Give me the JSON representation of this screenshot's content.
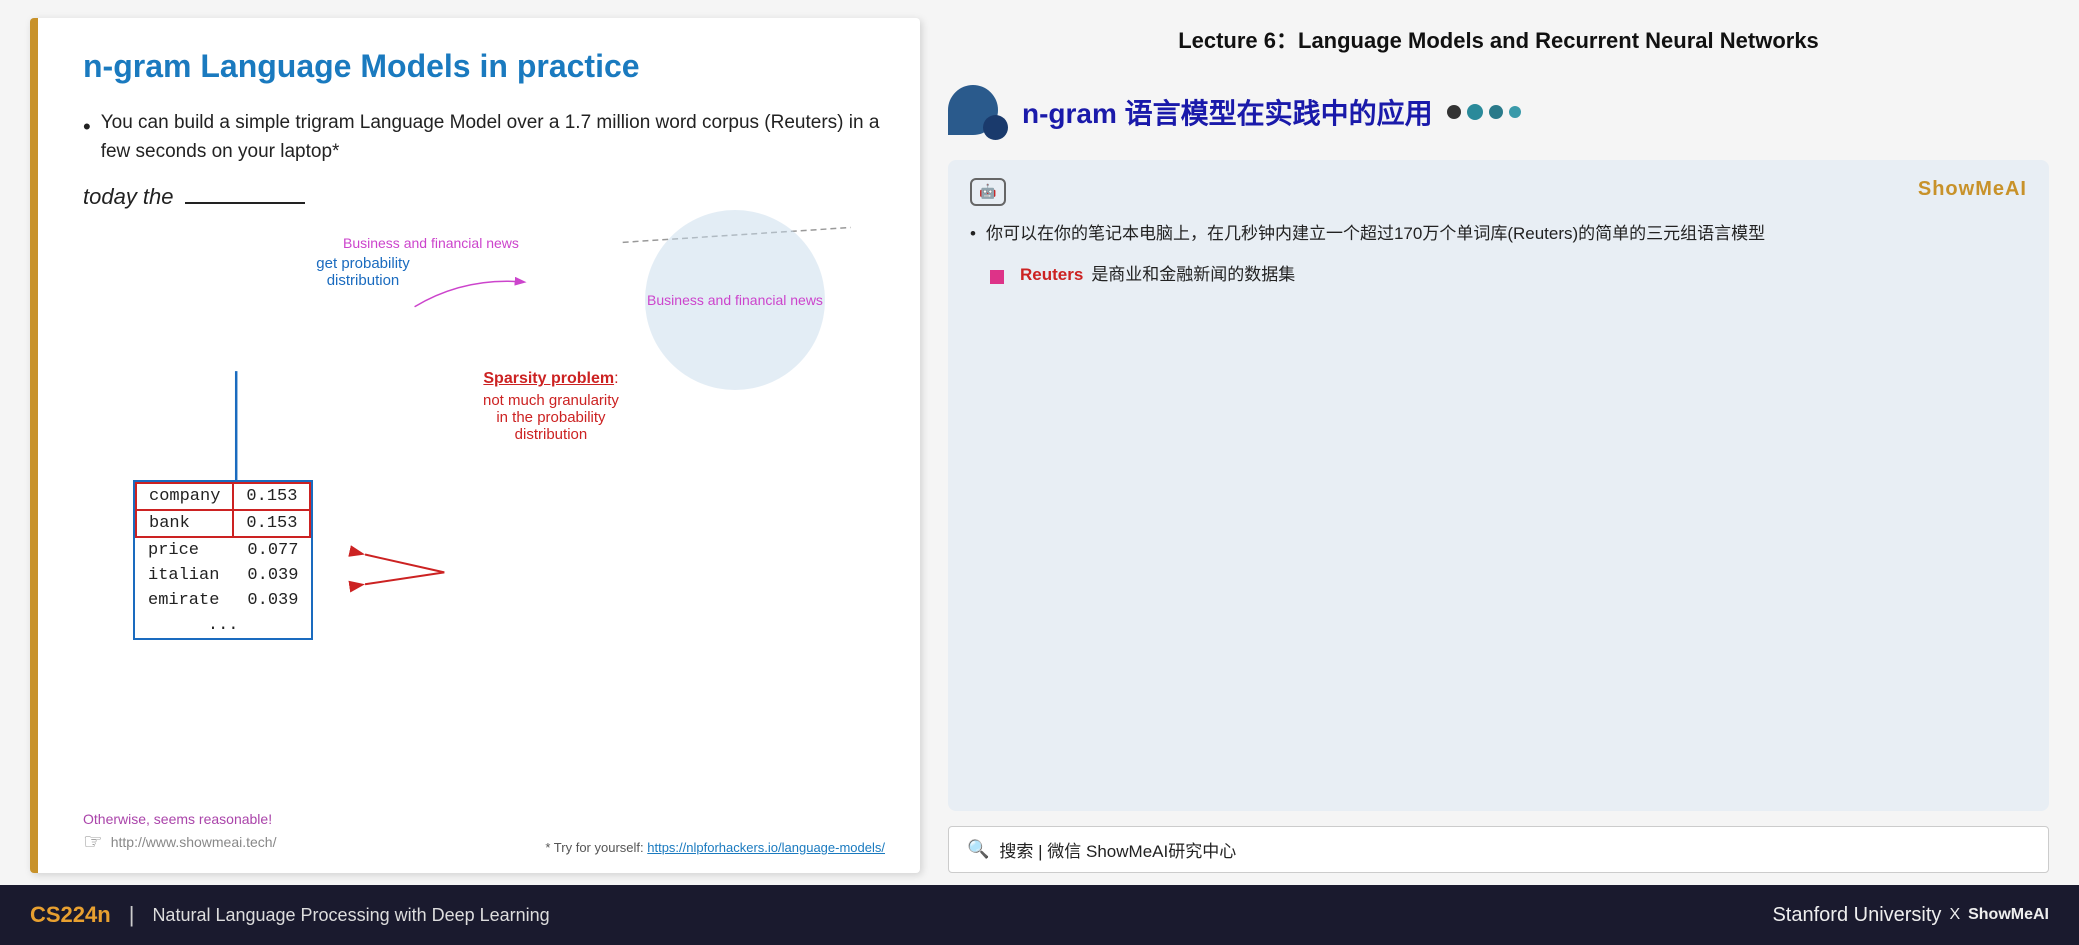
{
  "slide": {
    "title": "n-gram Language Models in practice",
    "bullet1_text": "You can build a simple trigram Language Model over a 1.7 million word corpus (Reuters) in a few seconds on your laptop*",
    "today_line": "today the",
    "business_bubble_label": "Business and financial news",
    "blue_arrow_label": "get probability\ndistribution",
    "prob_table": {
      "rows": [
        {
          "word": "company",
          "prob": "0.153"
        },
        {
          "word": "bank",
          "prob": "0.153"
        },
        {
          "word": "price",
          "prob": "0.077"
        },
        {
          "word": "italian",
          "prob": "0.039"
        },
        {
          "word": "emirate",
          "prob": "0.039"
        },
        {
          "word": "...",
          "prob": ""
        }
      ]
    },
    "sparsity_label": "Sparsity problem",
    "sparsity_desc": "not much granularity\nin the probability\ndistribution",
    "footer_reasonable": "Otherwise, seems reasonable!",
    "footer_url": "http://www.showmeai.tech/",
    "footer_try": "* Try for yourself:",
    "footer_link": "https://nlpforhackers.io/language-models/"
  },
  "right_panel": {
    "lecture_header": "Lecture 6：Language Models and Recurrent Neural Networks",
    "ngram_title": "n-gram 语言模型在实践中的应用",
    "ai_brand": "ShowMeAI",
    "ai_bullet1": "你可以在你的笔记本电脑上，在几秒钟内建立一个超过170万个单词库(Reuters)的简单的三元组语言模型",
    "reuters_label": "Reuters",
    "reuters_desc": "是商业和金融新闻的数据集",
    "search_text": "搜索 | 微信 ShowMeAI研究中心"
  },
  "bottom_bar": {
    "course_code": "CS224n",
    "divider": "|",
    "course_name": "Natural Language Processing with Deep Learning",
    "stanford": "Stanford University",
    "x": "X",
    "showmeai": "ShowMeAI"
  }
}
